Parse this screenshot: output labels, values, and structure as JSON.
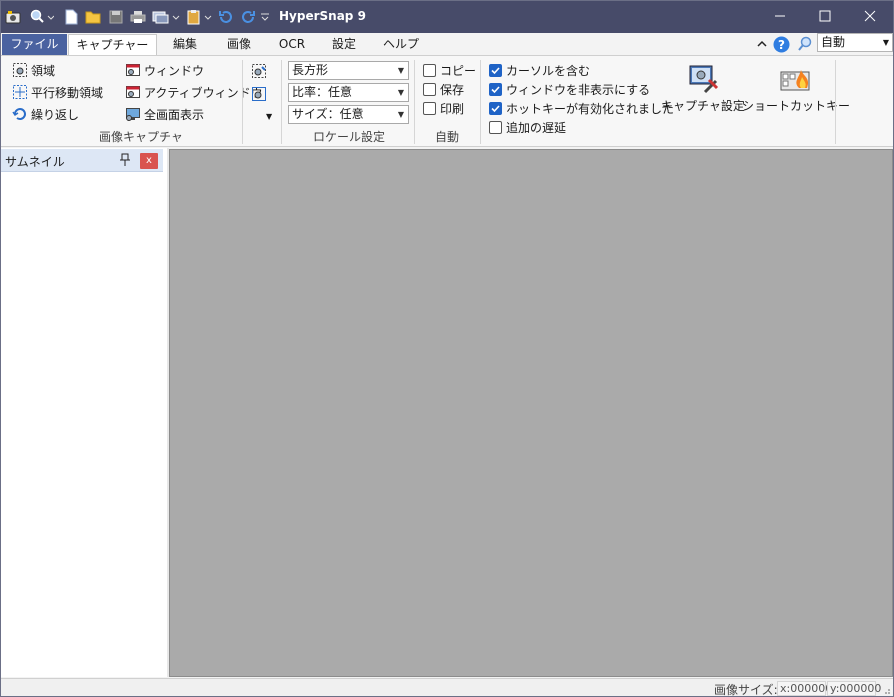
{
  "window": {
    "title": "HyperSnap 9"
  },
  "menu": {
    "file": "ファイル",
    "tabs": [
      "キャプチャー",
      "編集",
      "画像",
      "OCR",
      "設定",
      "ヘルプ"
    ],
    "zoom_value": "自動"
  },
  "ribbon": {
    "capture_group": {
      "label": "画像キャプチャ",
      "region": "領域",
      "scroll_region": "平行移動領域",
      "repeat": "繰り返し",
      "window": "ウィンドウ",
      "active_window": "アクティブウィンドウ",
      "full_screen": "全画面表示"
    },
    "locale_group": {
      "label": "ロケール設定",
      "shape": "長方形",
      "ratio": "比率：任意",
      "size": "サイズ：任意"
    },
    "auto_group": {
      "label": "自動",
      "copy": "コピー",
      "save": "保存",
      "print": "印刷"
    },
    "options": {
      "include_cursor": "カーソルを含む",
      "hide_window": "ウィンドウを非表示にする",
      "hotkey_enabled": "ホットキーが有効化されました",
      "add_delay": "追加の遅延"
    },
    "capture_settings": "キャプチャ設定",
    "shortcut_keys": "ショートカットキー"
  },
  "panel": {
    "title": "サムネイル",
    "close": "x"
  },
  "status": {
    "image_size_label": "画像サイズ:",
    "x": "x:000000",
    "y": "y:000000"
  },
  "colors": {
    "titlebar": "#474b69",
    "file_tab": "#4a62a0",
    "canvas": "#aaaaaa",
    "check_on": "#1f63c6"
  }
}
